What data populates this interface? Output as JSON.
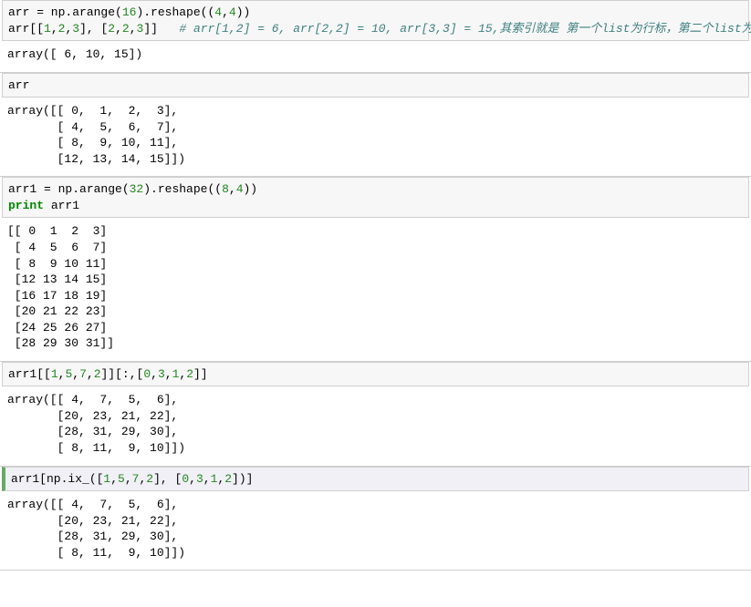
{
  "cells": [
    {
      "input_html": "arr = np.arange(<span class='tok-num'>16</span>).reshape((<span class='tok-num'>4</span>,<span class='tok-num'>4</span>))\narr[[<span class='tok-num'>1</span>,<span class='tok-num'>2</span>,<span class='tok-num'>3</span>], [<span class='tok-num'>2</span>,<span class='tok-num'>2</span>,<span class='tok-num'>3</span>]]   <span class='tok-comment'># arr[1,2] = 6, arr[2,2] = 10, arr[3,3] = 15,其索引就是 第一个list为行标，第二个list为列标</span>",
      "output": "array([ 6, 10, 15])",
      "active": false
    },
    {
      "input_html": "arr",
      "output": "array([[ 0,  1,  2,  3],\n       [ 4,  5,  6,  7],\n       [ 8,  9, 10, 11],\n       [12, 13, 14, 15]])",
      "active": false
    },
    {
      "input_html": "arr1 = np.arange(<span class='tok-num'>32</span>).reshape((<span class='tok-num'>8</span>,<span class='tok-num'>4</span>))\n<span class='tok-key'>print</span> arr1",
      "output": "[[ 0  1  2  3]\n [ 4  5  6  7]\n [ 8  9 10 11]\n [12 13 14 15]\n [16 17 18 19]\n [20 21 22 23]\n [24 25 26 27]\n [28 29 30 31]]",
      "active": false
    },
    {
      "input_html": "arr1[[<span class='tok-num'>1</span>,<span class='tok-num'>5</span>,<span class='tok-num'>7</span>,<span class='tok-num'>2</span>]][:,[<span class='tok-num'>0</span>,<span class='tok-num'>3</span>,<span class='tok-num'>1</span>,<span class='tok-num'>2</span>]]",
      "output": "array([[ 4,  7,  5,  6],\n       [20, 23, 21, 22],\n       [28, 31, 29, 30],\n       [ 8, 11,  9, 10]])",
      "active": false
    },
    {
      "input_html": "arr1[np.ix_([<span class='tok-num'>1</span>,<span class='tok-num'>5</span>,<span class='tok-num'>7</span>,<span class='tok-num'>2</span>], [<span class='tok-num'>0</span>,<span class='tok-num'>3</span>,<span class='tok-num'>1</span>,<span class='tok-num'>2</span>])]",
      "output": "array([[ 4,  7,  5,  6],\n       [20, 23, 21, 22],\n       [28, 31, 29, 30],\n       [ 8, 11,  9, 10]])",
      "active": true
    }
  ]
}
